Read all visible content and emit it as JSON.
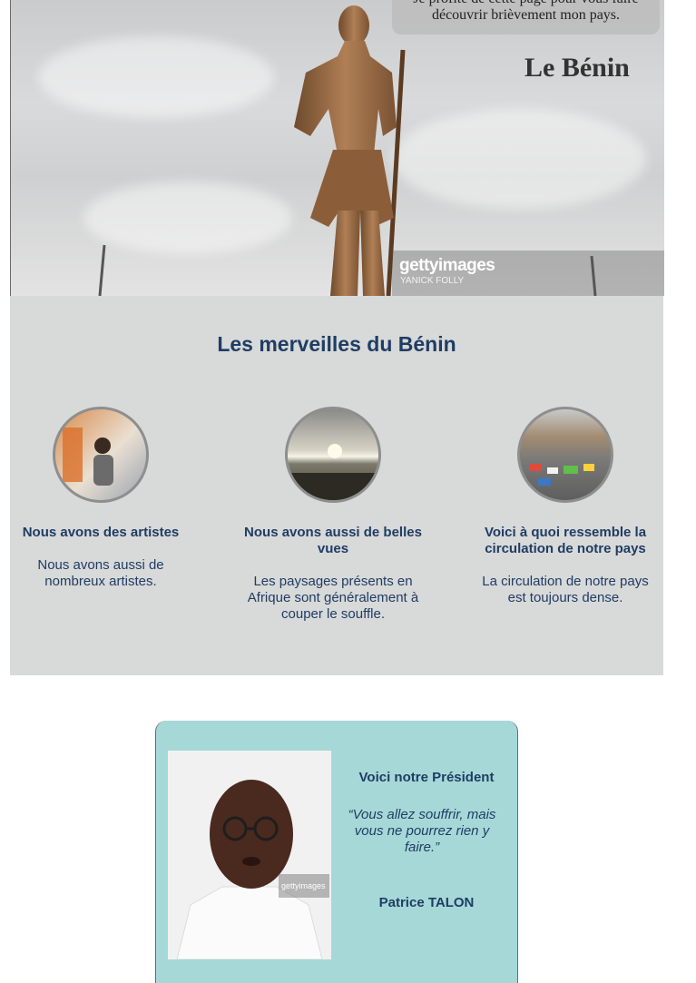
{
  "hero": {
    "intro": "Je profite de cette page pour vous faire découvrir brièvement mon pays.",
    "title": "Le Bénin",
    "watermark_brand": "gettyimages",
    "watermark_credit": "YANICK FOLLY"
  },
  "wonders": {
    "title": "Les merveilles du Bénin",
    "cards": [
      {
        "title": "Nous avons des artistes",
        "text": "Nous avons aussi de nombreux artistes."
      },
      {
        "title": "Nous avons aussi de belles vues",
        "text": "Les paysages présents en Afrique sont généralement à couper le souffle."
      },
      {
        "title": "Voici à quoi ressemble la circulation de notre pays",
        "text": "La circulation de notre pays est toujours dense."
      }
    ]
  },
  "president": {
    "title": "Voici notre Président",
    "quote": "“Vous allez souffrir, mais vous ne pourrez rien y faire.”",
    "name": "Patrice TALON",
    "photo_watermark": "gettyimages"
  },
  "colors": {
    "heading_navy": "#1f3d63",
    "section_grey": "#d8d9d9",
    "president_teal": "#a7d8d8"
  }
}
